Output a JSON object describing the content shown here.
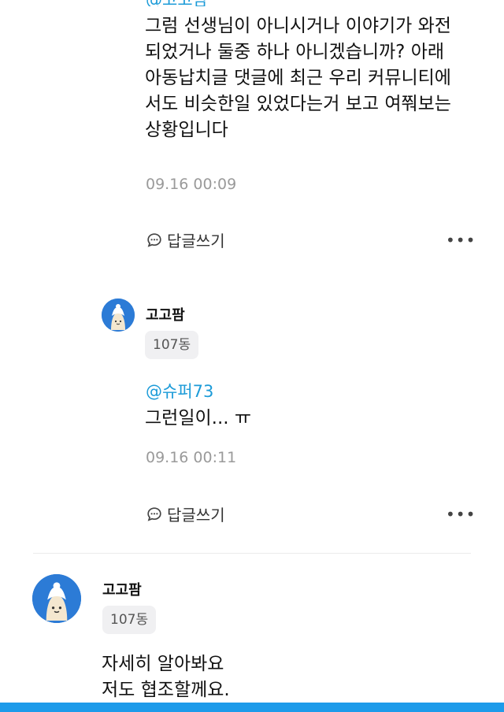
{
  "comment1": {
    "mention_cut": "@고고팜",
    "lines": [
      "그럼 선생님이 아니시거나 이야기가 와전",
      "되었거나 둘중 하나 아니겠습니까? 아래",
      "아동납치글 댓글에 최근 우리 커뮤니티에",
      "서도 비슷한일 있었다는거 보고 여쭤보는",
      "상황입니다"
    ],
    "time": "09.16 00:09",
    "reply_label": "답글쓰기",
    "more_label": "•••"
  },
  "reply": {
    "author": "고고팜",
    "badge": "107동",
    "mention": "@슈퍼73",
    "text": "그런일이... ㅠ",
    "time": "09.16 00:11",
    "reply_label": "답글쓰기",
    "more_label": "•••"
  },
  "comment2": {
    "author": "고고팜",
    "badge": "107동",
    "lines": [
      "자세히 알아봐요",
      "저도 협조할께요."
    ]
  },
  "colors": {
    "mention": "#1c9bd8",
    "avatar_bg": "#2c7bd6",
    "bottom_bar": "#1e9bea"
  }
}
